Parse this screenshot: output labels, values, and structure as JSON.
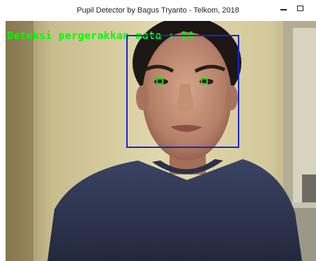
{
  "window": {
    "title": "Pupil Detector by Bagus Tryanto - Telkom, 2018"
  },
  "controls": {
    "minimize_icon": "minimize-icon",
    "maximize_icon": "maximize-icon"
  },
  "video": {
    "overlay_label": "Deteksi pergerakkan mata : 24"
  },
  "colors": {
    "overlay_text": "#00ff00",
    "face_box": "#1a24d6",
    "eye_box": "#00e000"
  }
}
